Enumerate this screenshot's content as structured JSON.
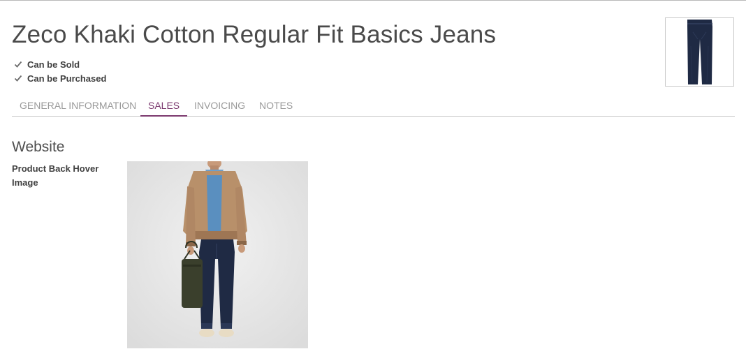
{
  "product": {
    "name": "Zeco Khaki Cotton Regular Fit Basics Jeans",
    "can_be_sold_label": "Can be Sold",
    "can_be_purchased_label": "Can be Purchased",
    "can_be_sold": true,
    "can_be_purchased": true
  },
  "tabs": [
    {
      "label": "GENERAL INFORMATION",
      "active": false
    },
    {
      "label": "SALES",
      "active": true
    },
    {
      "label": "INVOICING",
      "active": false
    },
    {
      "label": "NOTES",
      "active": false
    }
  ],
  "website": {
    "section_title": "Website",
    "back_hover_label": "Product Back Hover Image"
  },
  "colors": {
    "accent": "#7c3a6f",
    "jeans": "#1f2a44",
    "jacket": "#b8906a",
    "shirt": "#5a8fbf",
    "bag": "#3a3f2c"
  }
}
